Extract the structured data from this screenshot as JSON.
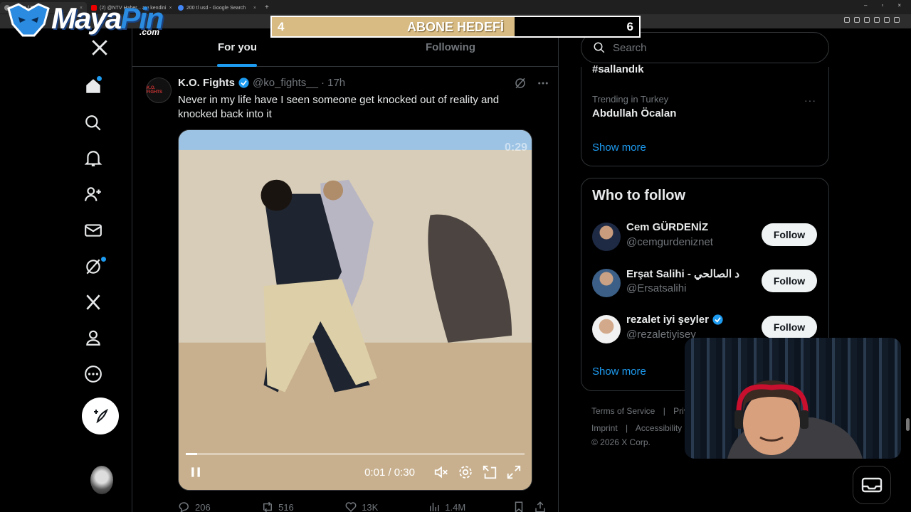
{
  "browser": {
    "tabs": [
      {
        "label": "Home / X",
        "favicon": "x-icon",
        "active": true
      },
      {
        "label": "(2) @NTV Haber... ayı kendini",
        "favicon": "youtube-icon",
        "active": false
      },
      {
        "label": "200 tl usd - Google Search",
        "favicon": "google-icon",
        "active": false
      }
    ],
    "new_tab": "+",
    "window_controls": [
      "–",
      "▫",
      "×"
    ]
  },
  "overlay": {
    "logo_main": "Maya",
    "logo_accent": "Pin",
    "logo_suffix": ".com",
    "goal_label": "ABONE HEDEFİ",
    "goal_current": "4",
    "goal_target": "6",
    "goal_progress": 0.66
  },
  "nav": {
    "items": [
      "x-logo-icon",
      "home-icon",
      "explore-icon",
      "notifications-icon",
      "follow-icon",
      "messages-icon",
      "grok-icon",
      "premium-icon",
      "profile-icon",
      "more-icon"
    ]
  },
  "timeline": {
    "tab_for_you": "For you",
    "tab_following": "Following"
  },
  "post": {
    "avatar_text": "K.O. FIGHTS",
    "author": "K.O. Fights",
    "handle": "@ko_fights__",
    "time": "· 17h",
    "text": "Never in my life have I seen someone get knocked out of reality and knocked back into it",
    "video_badge": "0:29",
    "video_time": "0:01 / 0:30",
    "video_progress": 0.033,
    "replies": "206",
    "reposts": "516",
    "likes": "13K",
    "views": "1.4M"
  },
  "sidebar": {
    "search_placeholder": "Search",
    "trend_top": "#sallandık",
    "trend_meta": "Trending in Turkey",
    "trend_name": "Abdullah Öcalan",
    "trend_more": "···",
    "show_more_1": "Show more",
    "who_to_follow_title": "Who to follow",
    "accounts": [
      {
        "name": "Cem GÜRDENİZ",
        "handle": "@cemgurdeniznet",
        "verified": false,
        "follow": "Follow"
      },
      {
        "name": "Erşat Salihi - د الصالحي",
        "handle": "@Ersatsalihi",
        "verified": false,
        "follow": "Follow"
      },
      {
        "name": "rezalet iyi şeyler",
        "handle": "@rezaletiyisey",
        "verified": true,
        "follow": "Follow"
      }
    ],
    "show_more_2": "Show more",
    "footer_line1": [
      "Terms of Service",
      "|",
      "Priva"
    ],
    "footer_line2": [
      "Imprint",
      "|",
      "Accessibility"
    ],
    "footer_line3": "© 2026 X Corp."
  },
  "colors": {
    "accent": "#1d9bf0",
    "goal_fill": "#d7bb83",
    "background": "#000000"
  }
}
